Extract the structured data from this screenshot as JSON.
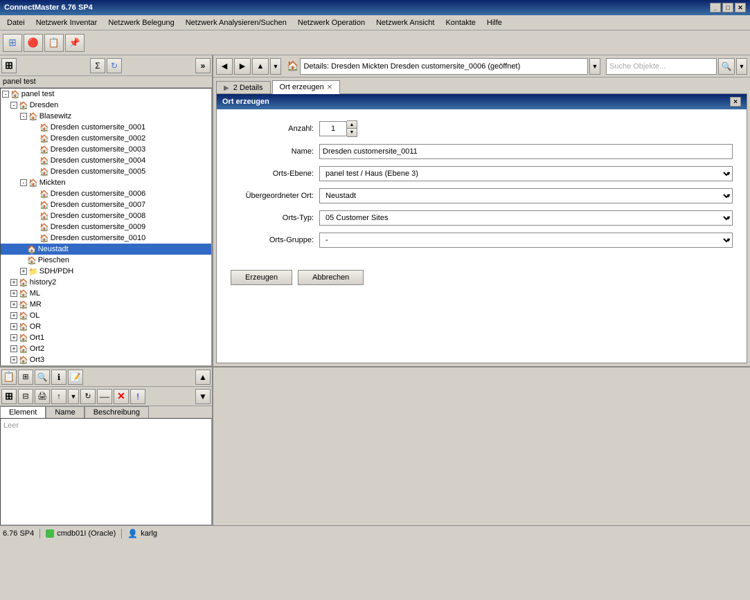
{
  "app": {
    "title": "ConnectMaster 6.76 SP4",
    "icon": "🏠"
  },
  "menu": {
    "items": [
      "Datei",
      "Netzwerk Inventar",
      "Netzwerk Belegung",
      "Netzwerk Analysieren/Suchen",
      "Netzwerk Operation",
      "Netzwerk Ansicht",
      "Kontakte",
      "Hilfe"
    ]
  },
  "right_toolbar": {
    "breadcrumb": "Details: Dresden Mickten Dresden customersite_0006  (geöffnet)",
    "search_placeholder": "Suche Objekte..."
  },
  "left_panel": {
    "panel_label": "panel test",
    "tree": {
      "root_label": "panel test",
      "items": [
        {
          "label": "Dresden",
          "level": 1,
          "expanded": true,
          "icon": "house"
        },
        {
          "label": "Blasewitz",
          "level": 2,
          "expanded": true,
          "icon": "house"
        },
        {
          "label": "Dresden customersite_0001",
          "level": 3,
          "icon": "house"
        },
        {
          "label": "Dresden customersite_0002",
          "level": 3,
          "icon": "house"
        },
        {
          "label": "Dresden customersite_0003",
          "level": 3,
          "icon": "house"
        },
        {
          "label": "Dresden customersite_0004",
          "level": 3,
          "icon": "house"
        },
        {
          "label": "Dresden customersite_0005",
          "level": 3,
          "icon": "house"
        },
        {
          "label": "Mickten",
          "level": 2,
          "expanded": true,
          "icon": "house"
        },
        {
          "label": "Dresden customersite_0006",
          "level": 3,
          "icon": "house"
        },
        {
          "label": "Dresden customersite_0007",
          "level": 3,
          "icon": "house"
        },
        {
          "label": "Dresden customersite_0008",
          "level": 3,
          "icon": "house"
        },
        {
          "label": "Dresden customersite_0009",
          "level": 3,
          "icon": "house"
        },
        {
          "label": "Dresden customersite_0010",
          "level": 3,
          "icon": "house"
        },
        {
          "label": "Neustadt",
          "level": 2,
          "selected": true,
          "icon": "house"
        },
        {
          "label": "Pieschen",
          "level": 2,
          "icon": "house"
        },
        {
          "label": "SDH/PDH",
          "level": 2,
          "icon": "folder"
        },
        {
          "label": "history2",
          "level": 1,
          "icon": "house"
        },
        {
          "label": "ML",
          "level": 1,
          "icon": "house"
        },
        {
          "label": "MR",
          "level": 1,
          "icon": "house"
        },
        {
          "label": "OL",
          "level": 1,
          "icon": "house"
        },
        {
          "label": "OR",
          "level": 1,
          "icon": "house"
        },
        {
          "label": "Ort1",
          "level": 1,
          "icon": "house"
        },
        {
          "label": "Ort2",
          "level": 1,
          "icon": "house"
        },
        {
          "label": "Ort3",
          "level": 1,
          "icon": "house"
        }
      ]
    }
  },
  "dialog": {
    "title": "Ort erzeugen",
    "close_btn": "×",
    "fields": {
      "anzahl_label": "Anzahl:",
      "anzahl_value": "1",
      "name_label": "Name:",
      "name_value": "Dresden customersite_0011",
      "orts_ebene_label": "Orts-Ebene:",
      "orts_ebene_value": "panel test / Haus (Ebene 3)",
      "uebergeordneter_ort_label": "Übergeordneter Ort:",
      "uebergeordneter_ort_value": "Neustadt",
      "orts_typ_label": "Orts-Typ:",
      "orts_typ_value": "05 Customer Sites",
      "orts_gruppe_label": "Orts-Gruppe:",
      "orts_gruppe_value": "-"
    },
    "buttons": {
      "erzeugen": "Erzeugen",
      "abbrechen": "Abbrechen"
    }
  },
  "tabs": {
    "details_tab": "2 Details",
    "ort_erzeugen_tab": "Ort erzeugen"
  },
  "bottom_panel": {
    "tabs": [
      "Element",
      "Name",
      "Beschreibung"
    ],
    "active_tab": "Element",
    "empty_text": "Leer"
  },
  "status_bar": {
    "version": "6.76 SP4",
    "db": "cmdb01I (Oracle)",
    "user": "karlg"
  }
}
